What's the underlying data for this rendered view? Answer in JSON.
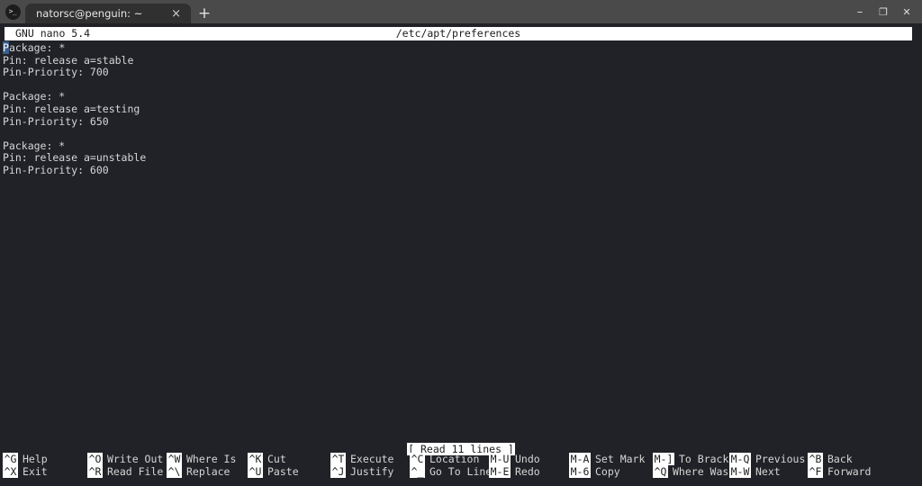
{
  "window": {
    "tab": {
      "title": "natorsc@penguin: ~",
      "icon": "terminal-icon",
      "close_label": "×"
    },
    "new_tab_label": "+",
    "controls": {
      "minimize": "–",
      "maximize": "❐",
      "close": "✕"
    },
    "colors": {
      "titlebar_bg": "#4a4a4a",
      "tab_bg": "#303030",
      "terminal_bg": "#202227",
      "terminal_fg": "#d6d6d6",
      "inverse_bg": "#ffffff",
      "inverse_fg": "#1c1c1c",
      "cursor_bg": "#3b5e8c"
    }
  },
  "nano": {
    "version": "GNU nano 5.4",
    "filename": "/etc/apt/preferences",
    "status_message": "[ Read 11 lines ]",
    "buffer_lines": [
      "Package: *",
      "Pin: release a=stable",
      "Pin-Priority: 700",
      "",
      "Package: *",
      "Pin: release a=testing",
      "Pin-Priority: 650",
      "",
      "Package: *",
      "Pin: release a=unstable",
      "Pin-Priority: 600"
    ],
    "cursor": {
      "line": 0,
      "column": 0,
      "char": "P"
    },
    "shortcuts_row1": [
      {
        "key": "^G",
        "label": "Help"
      },
      {
        "key": "^O",
        "label": "Write Out"
      },
      {
        "key": "^W",
        "label": "Where Is"
      },
      {
        "key": "^K",
        "label": "Cut"
      },
      {
        "key": "^T",
        "label": "Execute"
      },
      {
        "key": "^C",
        "label": "Location"
      },
      {
        "key": "M-U",
        "label": "Undo"
      },
      {
        "key": "M-A",
        "label": "Set Mark"
      },
      {
        "key": "M-]",
        "label": "To Bracket"
      },
      {
        "key": "M-Q",
        "label": "Previous"
      },
      {
        "key": "^B",
        "label": "Back"
      }
    ],
    "shortcuts_row2": [
      {
        "key": "^X",
        "label": "Exit"
      },
      {
        "key": "^R",
        "label": "Read File"
      },
      {
        "key": "^\\",
        "label": "Replace"
      },
      {
        "key": "^U",
        "label": "Paste"
      },
      {
        "key": "^J",
        "label": "Justify"
      },
      {
        "key": "^_",
        "label": "Go To Line"
      },
      {
        "key": "M-E",
        "label": "Redo"
      },
      {
        "key": "M-6",
        "label": "Copy"
      },
      {
        "key": "^Q",
        "label": "Where Was"
      },
      {
        "key": "M-W",
        "label": "Next"
      },
      {
        "key": "^F",
        "label": "Forward"
      }
    ]
  }
}
